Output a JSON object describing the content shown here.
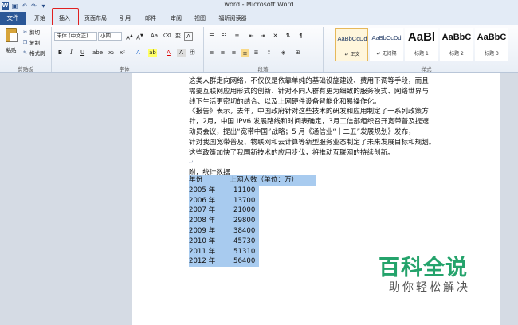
{
  "window": {
    "title": "word - Microsoft Word"
  },
  "quick_access": [
    "save-icon",
    "undo-icon",
    "redo-icon",
    "customize-icon"
  ],
  "tabs": [
    {
      "label": "文件"
    },
    {
      "label": "开始"
    },
    {
      "label": "插入"
    },
    {
      "label": "页面布局"
    },
    {
      "label": "引用"
    },
    {
      "label": "邮件"
    },
    {
      "label": "审阅"
    },
    {
      "label": "视图"
    },
    {
      "label": "福昕阅读器"
    }
  ],
  "ribbon": {
    "clipboard": {
      "paste": "粘贴",
      "cut": "剪切",
      "copy": "复制",
      "format_painter": "格式刷",
      "group": "剪贴板"
    },
    "font": {
      "font_name": "宋体 (中文正)",
      "font_size": "小四",
      "group": "字体"
    },
    "paragraph": {
      "group": "段落"
    },
    "styles": {
      "group": "样式",
      "items": [
        {
          "sample": "AaBbCcDd",
          "name": "↵ 正文"
        },
        {
          "sample": "AaBbCcDd",
          "name": "↵ 无间隔"
        },
        {
          "sample": "AaBl",
          "name": "标题 1"
        },
        {
          "sample": "AaBbC",
          "name": "标题 2"
        },
        {
          "sample": "AaBbC",
          "name": "标题 3"
        }
      ]
    }
  },
  "document": {
    "lines": [
      "这类人群走向网络，不仅仅是依靠单纯的基础设施建设、费用下调等手段，而且",
      "需要互联网应用形式的创新、针对不同人群有更为细致的服务模式、网络世界与",
      "线下生活更密切的结合、以及上网硬件设备智能化和易操作化。",
      "《报告》表示，去年，中国政府针对这些技术的研发和应用制定了一系列政策方",
      "针，2月，中国 IPv6 发展路线和时间表确定，3月工信部组织召开宽带普及提速",
      "动员会议，提出“宽带中国”战略；5 月《通信业“十二五”发展规划》发布，",
      "针对我国宽带普及、物联网和云计算等新型服务业态制定了未来发展目标和规划。",
      "这些政策加快了我国新技术的应用步伐，将推动互联网的持续创新。"
    ],
    "appendix": "附，统计数据",
    "table_header": [
      "年份",
      "上网人数（单位：万）"
    ],
    "table_rows": [
      [
        "2005 年",
        "11100"
      ],
      [
        "2006 年",
        "13700"
      ],
      [
        "2007 年",
        "21000"
      ],
      [
        "2008 年",
        "29800"
      ],
      [
        "2009 年",
        "38400"
      ],
      [
        "2010 年",
        "45730"
      ],
      [
        "2011 年",
        "51310"
      ],
      [
        "2012 年",
        "56400"
      ]
    ]
  },
  "watermark": {
    "title": "百科全说",
    "subtitle": "助你轻松解决"
  }
}
